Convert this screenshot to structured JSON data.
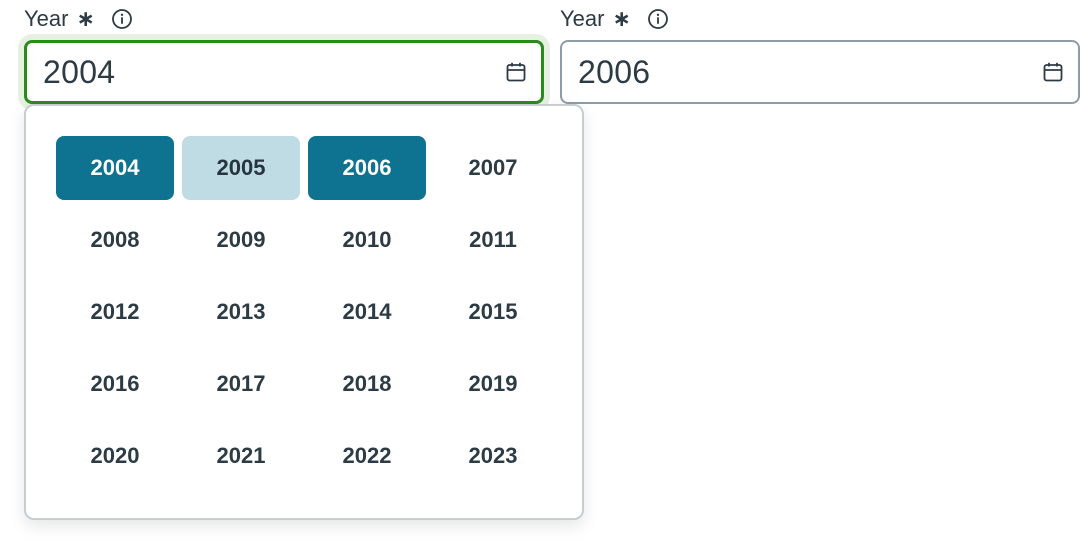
{
  "start_field": {
    "label": "Year",
    "required_mark": "∗",
    "value": "2004",
    "info_icon": "info-circle-icon",
    "calendar_icon": "calendar-icon"
  },
  "end_field": {
    "label": "Year",
    "required_mark": "∗",
    "value": "2006",
    "info_icon": "info-circle-icon",
    "calendar_icon": "calendar-icon"
  },
  "year_picker": {
    "years": [
      {
        "label": "2004",
        "state": "selected"
      },
      {
        "label": "2005",
        "state": "in-range"
      },
      {
        "label": "2006",
        "state": "selected"
      },
      {
        "label": "2007",
        "state": "normal"
      },
      {
        "label": "2008",
        "state": "normal"
      },
      {
        "label": "2009",
        "state": "normal"
      },
      {
        "label": "2010",
        "state": "normal"
      },
      {
        "label": "2011",
        "state": "normal"
      },
      {
        "label": "2012",
        "state": "normal"
      },
      {
        "label": "2013",
        "state": "normal"
      },
      {
        "label": "2014",
        "state": "normal"
      },
      {
        "label": "2015",
        "state": "normal"
      },
      {
        "label": "2016",
        "state": "normal"
      },
      {
        "label": "2017",
        "state": "normal"
      },
      {
        "label": "2018",
        "state": "normal"
      },
      {
        "label": "2019",
        "state": "normal"
      },
      {
        "label": "2020",
        "state": "normal"
      },
      {
        "label": "2021",
        "state": "normal"
      },
      {
        "label": "2022",
        "state": "normal"
      },
      {
        "label": "2023",
        "state": "normal"
      }
    ]
  },
  "colors": {
    "selected": "#0e7391",
    "in_range": "#bfdce5",
    "focus_border": "#2b8a1e",
    "text": "#2d3b45"
  }
}
